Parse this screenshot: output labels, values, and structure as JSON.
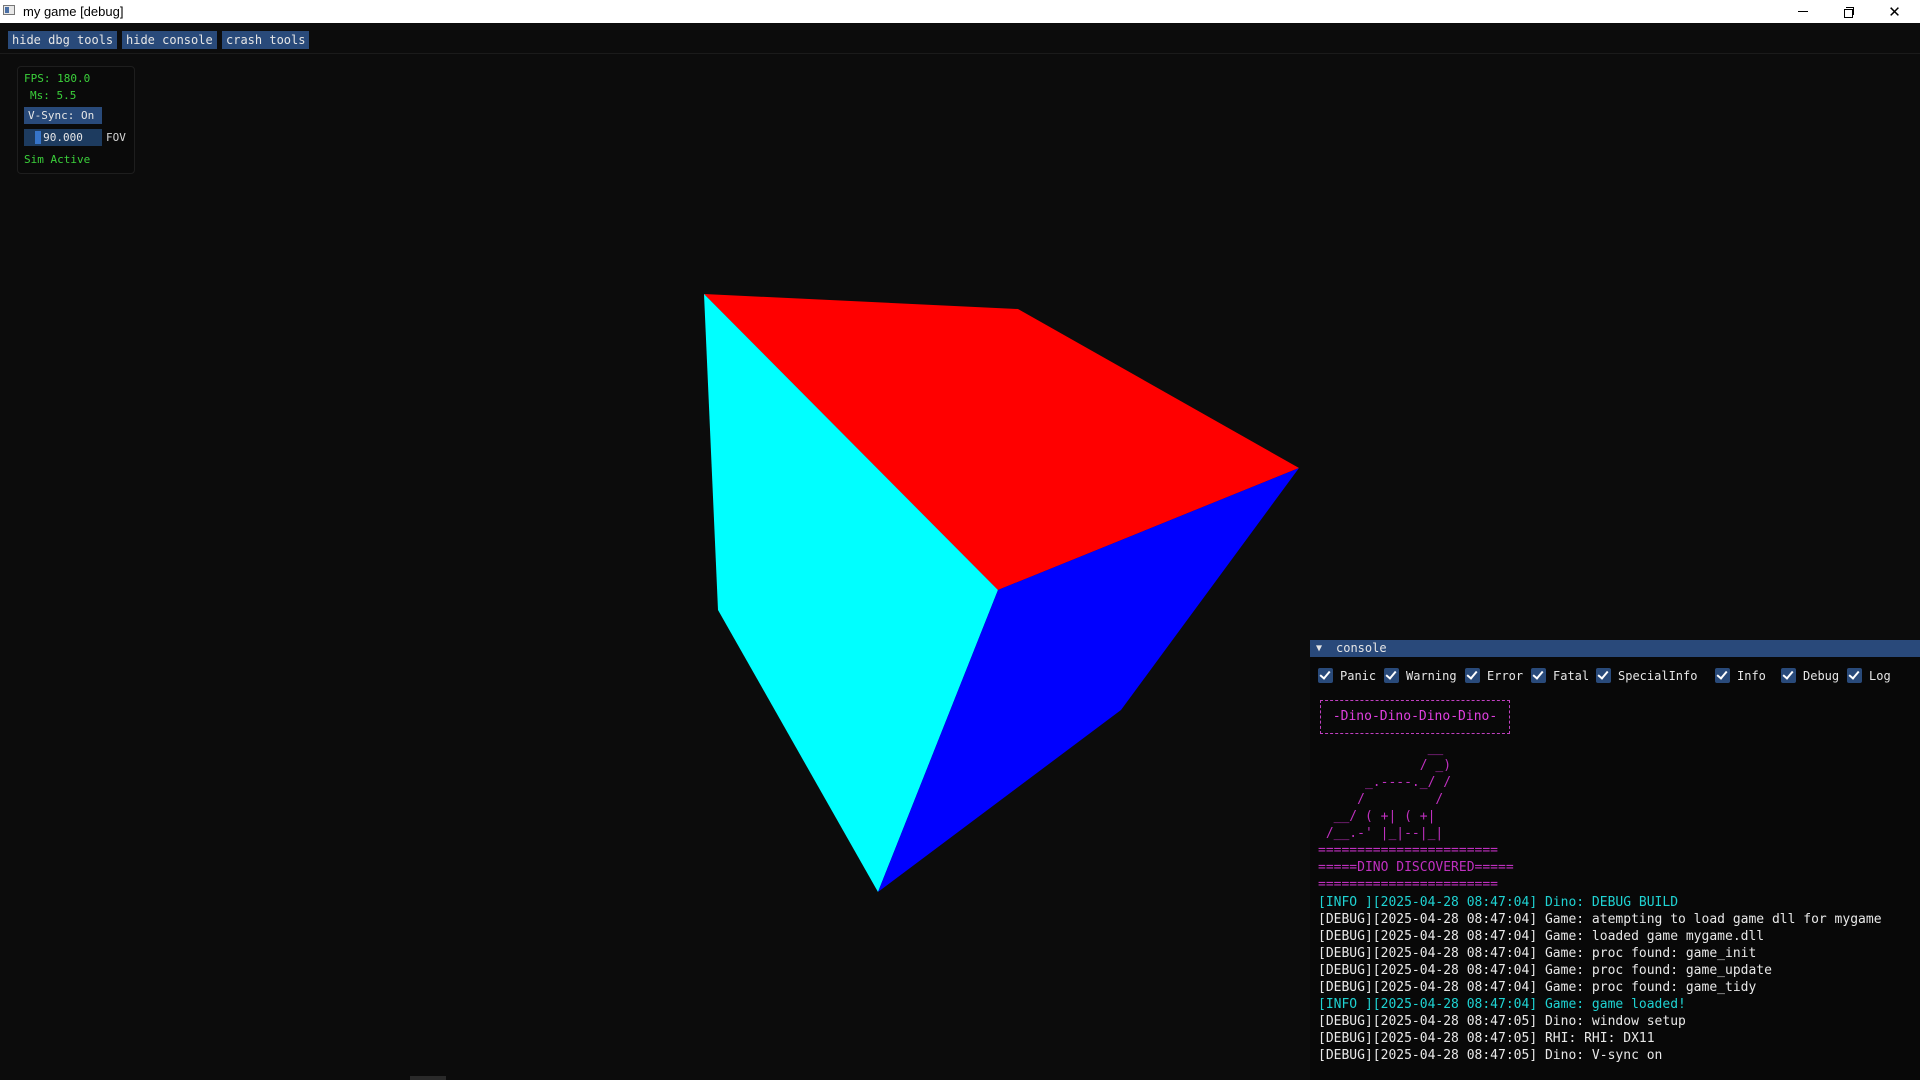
{
  "window": {
    "title": "my game [debug]"
  },
  "toolbar": {
    "buttons": [
      "hide dbg tools",
      "hide console",
      "crash tools"
    ]
  },
  "stats": {
    "fps": "FPS: 180.0",
    "ms": "Ms: 5.5",
    "vsync": "V-Sync: On",
    "fov_value": "90.000",
    "fov_label": "FOV",
    "sim_status": "Sim Active"
  },
  "scene": {
    "cube_faces": [
      {
        "name": "top-face",
        "color": "#ff0000"
      },
      {
        "name": "left-face",
        "color": "#00ffff"
      },
      {
        "name": "right-face",
        "color": "#0000ff"
      }
    ]
  },
  "console": {
    "header": "console",
    "filters": [
      {
        "label": "Panic",
        "checked": true
      },
      {
        "label": "Warning",
        "checked": true
      },
      {
        "label": "Error",
        "checked": true
      },
      {
        "label": "Fatal",
        "checked": true
      },
      {
        "label": "SpecialInfo",
        "checked": true
      },
      {
        "label": "Info",
        "checked": true
      },
      {
        "label": "Debug",
        "checked": true
      },
      {
        "label": "Log",
        "checked": true
      }
    ],
    "banner": "-Dino-Dino-Dino-Dino-",
    "ascii_art": "              __\n             / _)\n      _.----._/ /\n     /         /\n  __/ ( +| ( +|\n /__.-' |_|--|_|\n=======================\n=====DINO DISCOVERED=====\n=======================",
    "log": [
      {
        "level": "info",
        "text": "[INFO ][2025-04-28 08:47:04] Dino: DEBUG BUILD"
      },
      {
        "level": "debug",
        "text": "[DEBUG][2025-04-28 08:47:04] Game: atempting to load game dll for mygame"
      },
      {
        "level": "debug",
        "text": "[DEBUG][2025-04-28 08:47:04] Game: loaded game mygame.dll"
      },
      {
        "level": "debug",
        "text": "[DEBUG][2025-04-28 08:47:04] Game: proc found: game_init"
      },
      {
        "level": "debug",
        "text": "[DEBUG][2025-04-28 08:47:04] Game: proc found: game_update"
      },
      {
        "level": "debug",
        "text": "[DEBUG][2025-04-28 08:47:04] Game: proc found: game_tidy"
      },
      {
        "level": "info",
        "text": "[INFO ][2025-04-28 08:47:04] Game: game loaded!"
      },
      {
        "level": "debug",
        "text": "[DEBUG][2025-04-28 08:47:05] Dino: window setup"
      },
      {
        "level": "debug",
        "text": "[DEBUG][2025-04-28 08:47:05] RHI: RHI: DX11"
      },
      {
        "level": "debug",
        "text": "[DEBUG][2025-04-28 08:47:05] Dino: V-sync on"
      }
    ]
  }
}
